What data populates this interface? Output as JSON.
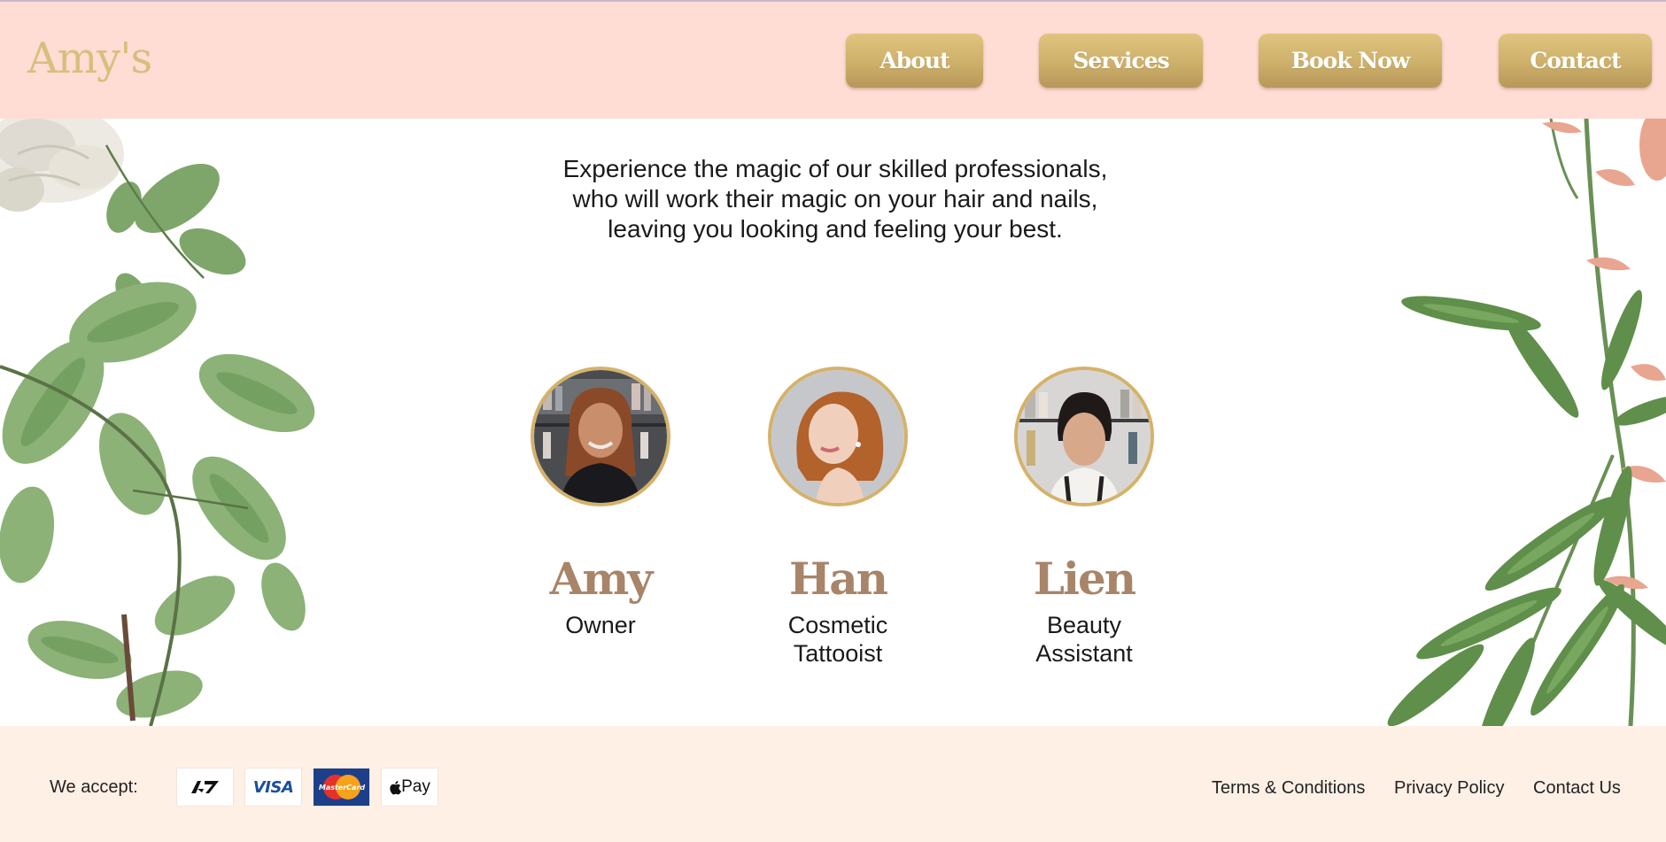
{
  "header": {
    "logo": "Amy's",
    "nav": {
      "about": "About",
      "services": "Services",
      "book_now": "Book Now",
      "contact": "Contact"
    }
  },
  "main": {
    "intro_lines": [
      "Experience the magic of our skilled professionals,",
      "who will work their magic on your hair and nails,",
      "leaving you looking and feeling your best."
    ],
    "team": [
      {
        "name": "Amy",
        "role": "Owner"
      },
      {
        "name": "Han",
        "role": "Cosmetic Tattooist"
      },
      {
        "name": "Lien",
        "role": "Beauty Assistant"
      }
    ]
  },
  "footer": {
    "accept_label": "We accept:",
    "payment_methods": [
      {
        "icon": "afterpay-icon"
      },
      {
        "icon": "visa-icon",
        "text": "VISA"
      },
      {
        "icon": "mastercard-icon",
        "text": "MasterCard"
      },
      {
        "icon": "apple-pay-icon",
        "text": "Pay"
      }
    ],
    "links": {
      "terms": "Terms & Conditions",
      "privacy": "Privacy Policy",
      "contact": "Contact Us"
    }
  },
  "colors": {
    "header_bg": "#ffdcd4",
    "footer_bg": "#fff0e6",
    "gold": "#d5b26a",
    "name_brown": "#a88468"
  }
}
